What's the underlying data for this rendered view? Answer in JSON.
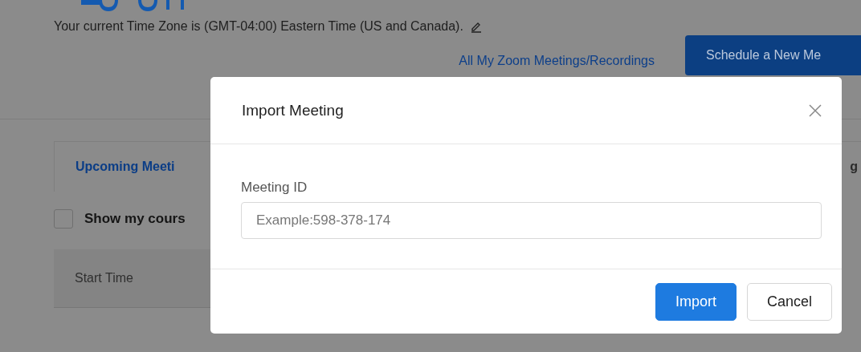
{
  "page": {
    "timezone": "Your current Time Zone is (GMT-04:00) Eastern Time (US and Canada).",
    "meetings_link": "All My Zoom Meetings/Recordings",
    "schedule_button": "Schedule a New Me",
    "tabs": [
      {
        "label": "Upcoming Meeti",
        "selected": true
      },
      {
        "label": "g",
        "selected": false
      }
    ],
    "show_courses": {
      "label": "Show my cours",
      "checked": false
    },
    "table": {
      "columns": [
        "Start Time"
      ]
    }
  },
  "dialog": {
    "title": "Import Meeting",
    "field_label": "Meeting ID",
    "placeholder": "Example:598-378-174",
    "buttons": [
      {
        "label": "Import",
        "kind": "primary"
      },
      {
        "label": "Cancel",
        "kind": "secondary"
      }
    ]
  }
}
